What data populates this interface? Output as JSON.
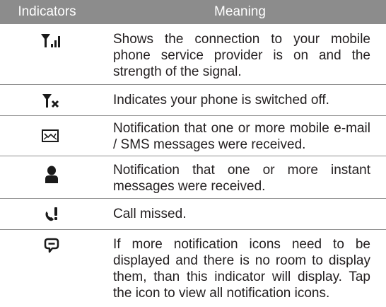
{
  "header": {
    "col_indicators": "Indicators",
    "col_meaning": "Meaning"
  },
  "rows": [
    {
      "icon": "signal-strength-icon",
      "text": "Shows the connection to your mobile phone service provider is on and the strength of the signal."
    },
    {
      "icon": "signal-off-icon",
      "text": "Indicates your phone is switched off."
    },
    {
      "icon": "message-envelope-icon",
      "text": "Notification that one or more mobile e-mail / SMS messages were received."
    },
    {
      "icon": "instant-message-person-icon",
      "text": "Notification that one or more instant messages were received."
    },
    {
      "icon": "missed-call-icon",
      "text": "Call missed."
    },
    {
      "icon": "notification-bubble-icon",
      "text": "If more notification icons need to be displayed and there is no room to display them, than this indicator will display. Tap the icon to view all notification icons."
    }
  ]
}
